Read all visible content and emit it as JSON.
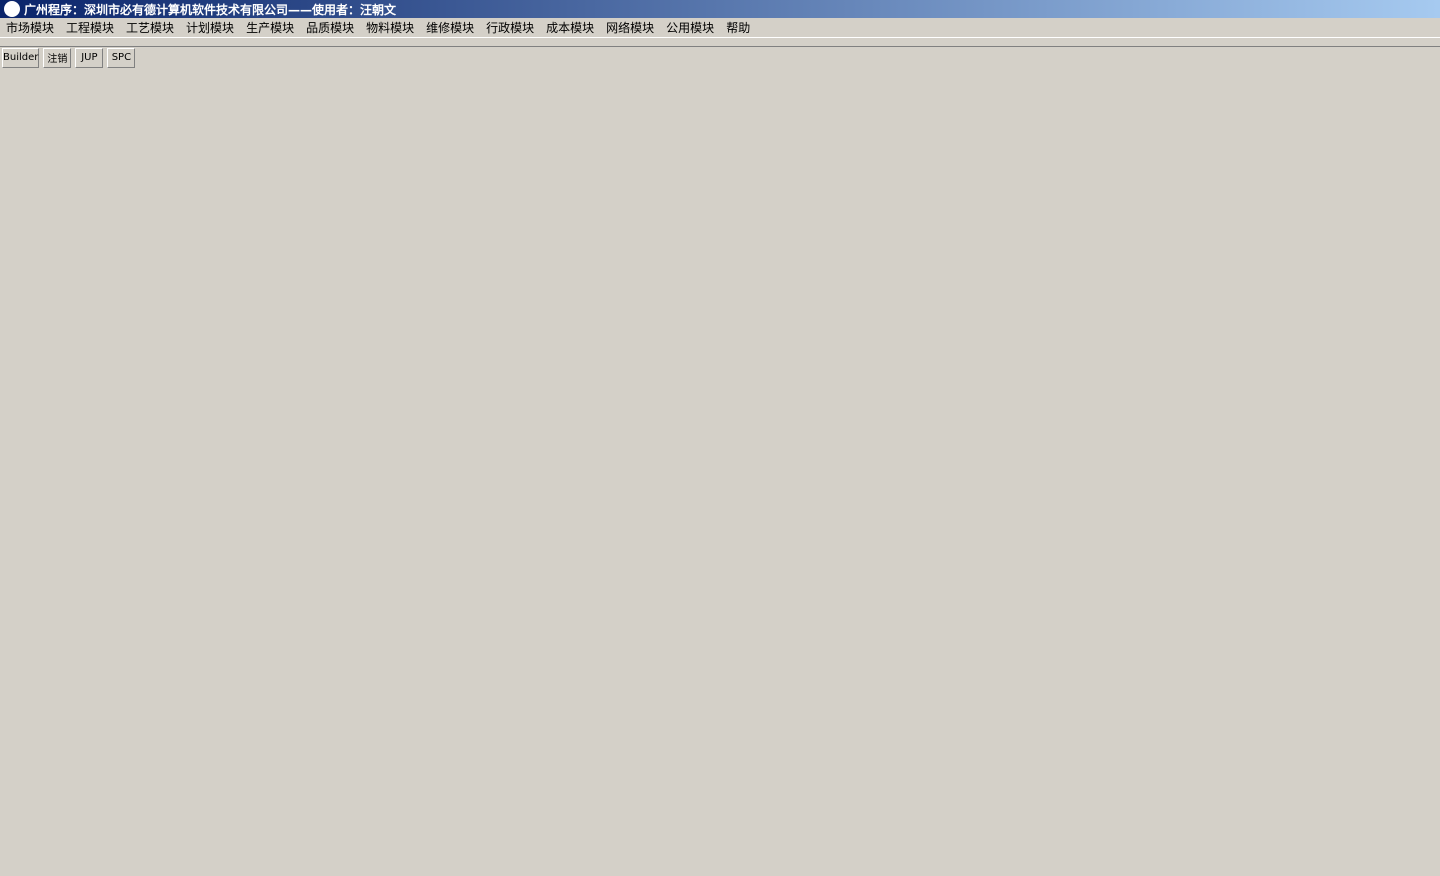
{
  "app_title": "广州程序：深圳市必有德计算机软件技术有限公司——使用者：汪朝文",
  "menus": [
    "市场模块",
    "工程模块",
    "工艺模块",
    "计划模块",
    "生产模块",
    "品质模块",
    "物料模块",
    "维修模块",
    "行政模块",
    "成本模块",
    "网络模块",
    "公用模块",
    "帮助"
  ],
  "toolbar": [
    "Builder",
    "注销",
    "JUP",
    "SPC"
  ]
}
